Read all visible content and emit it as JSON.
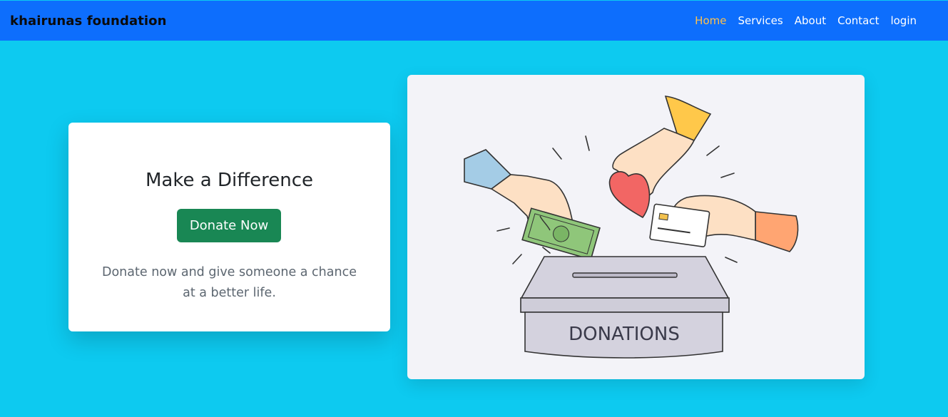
{
  "navbar": {
    "brand": "khairunas foundation",
    "links": [
      {
        "label": "Home",
        "active": true
      },
      {
        "label": "Services",
        "active": false
      },
      {
        "label": "About",
        "active": false
      },
      {
        "label": "Contact",
        "active": false
      },
      {
        "label": "login",
        "active": false
      }
    ]
  },
  "hero": {
    "title": "Make a Difference",
    "button_label": "Donate Now",
    "description": "Donate now and give someone a chance at a better life."
  },
  "illustration": {
    "box_label": "DONATIONS"
  },
  "colors": {
    "page_background": "#0dcaf0",
    "navbar": "#0d6efd",
    "active_link": "#ffc14d",
    "button": "#198754"
  }
}
